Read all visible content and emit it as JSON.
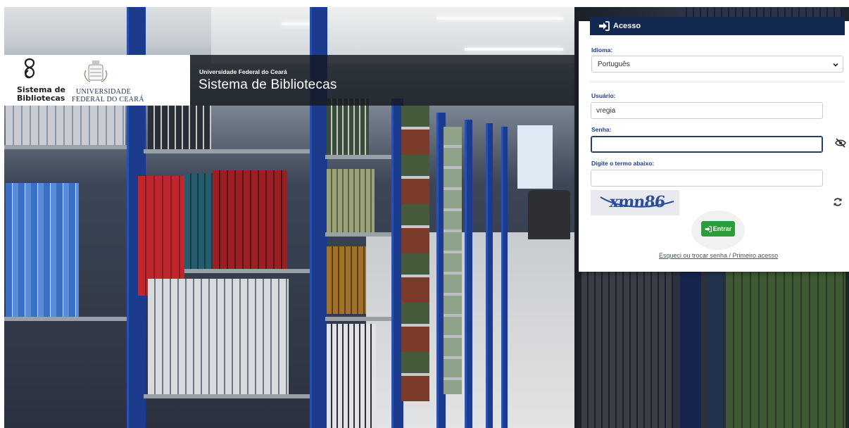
{
  "header": {
    "org_name": "Universidade Federal do Ceará",
    "system_name": "Sistema de Bibliotecas"
  },
  "logo": {
    "sb_line1": "Sistema de",
    "sb_line2": "Bibliotecas",
    "ufc_line1": "UNIVERSIDADE",
    "ufc_line2": "FEDERAL DO CEARÁ"
  },
  "login": {
    "title": "Acesso",
    "language_label": "Idioma:",
    "language_value": "Português",
    "user_label": "Usuário:",
    "user_value": "vregia",
    "password_label": "Senha:",
    "password_value": "",
    "captcha_label": "Digite o termo abaixo:",
    "captcha_input_value": "",
    "captcha_text": "xmn86",
    "submit_label": "Entrar",
    "forgot_link": "Esqueci ou trocar senha / Primeiro acesso"
  },
  "icons": {
    "header": "sign-in-icon",
    "select": "chevron-down-icon",
    "password_toggle": "eye-slash-icon",
    "captcha_refresh": "refresh-icon",
    "submit": "sign-in-icon"
  },
  "colors": {
    "header_bg": "#13284f",
    "label_blue": "#1e3d8b",
    "submit_green": "#2e9b3c"
  }
}
